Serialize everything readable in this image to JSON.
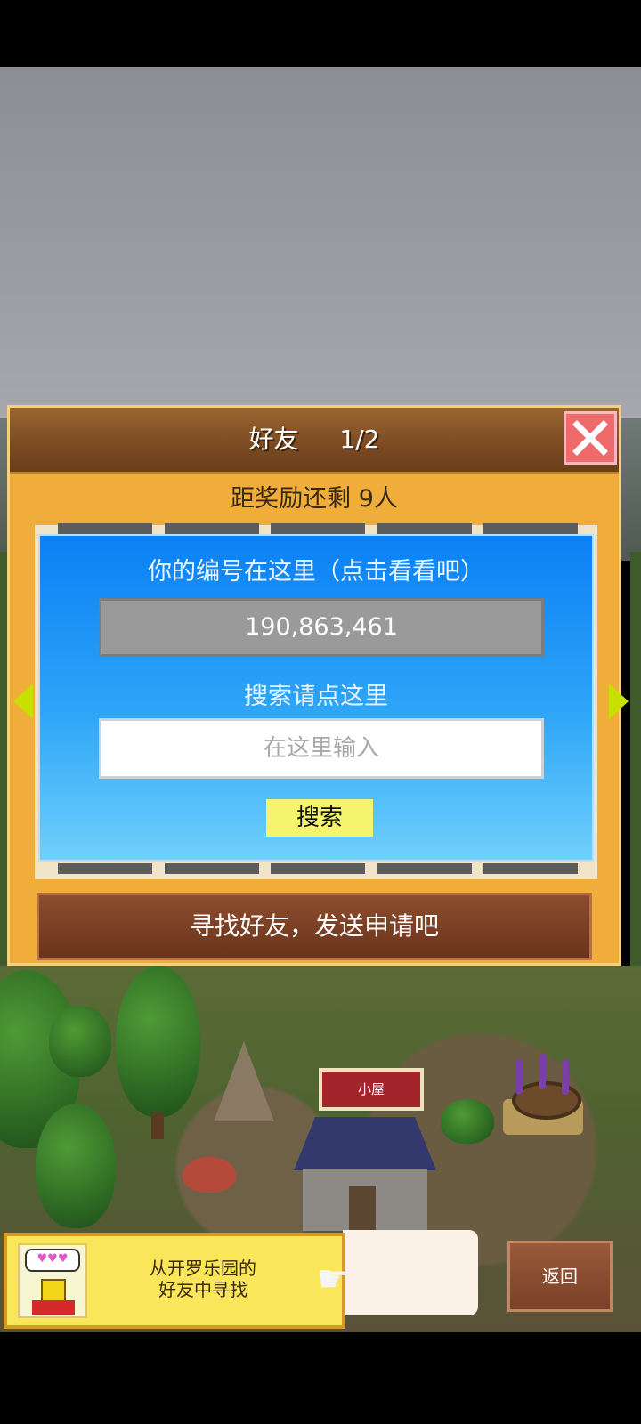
{
  "dialog": {
    "title": "好友",
    "page_indicator": "1/2",
    "reward_text": "距奖励还剩 9人",
    "id_label": "你的编号在这里（点击看看吧）",
    "player_id": "190,863,461",
    "search_label": "搜索请点这里",
    "search_placeholder": "在这里输入",
    "search_button": "搜索",
    "find_friends_button": "寻找好友，发送申请吧"
  },
  "scene": {
    "building_label": "小屋"
  },
  "footer": {
    "hint_line1": "从开罗乐园的",
    "hint_line2": "好友中寻找",
    "back_button": "返回"
  },
  "colors": {
    "dialog_bg": "#f0ad39",
    "panel_blue": "#0a80f5",
    "search_button": "#f5f56d",
    "close_button": "#ef6b6b",
    "arrow": "#c8e000"
  },
  "icons": [
    "close-icon",
    "arrow-left-icon",
    "arrow-right-icon",
    "pointing-hand-icon",
    "chick-avatar-icon"
  ]
}
